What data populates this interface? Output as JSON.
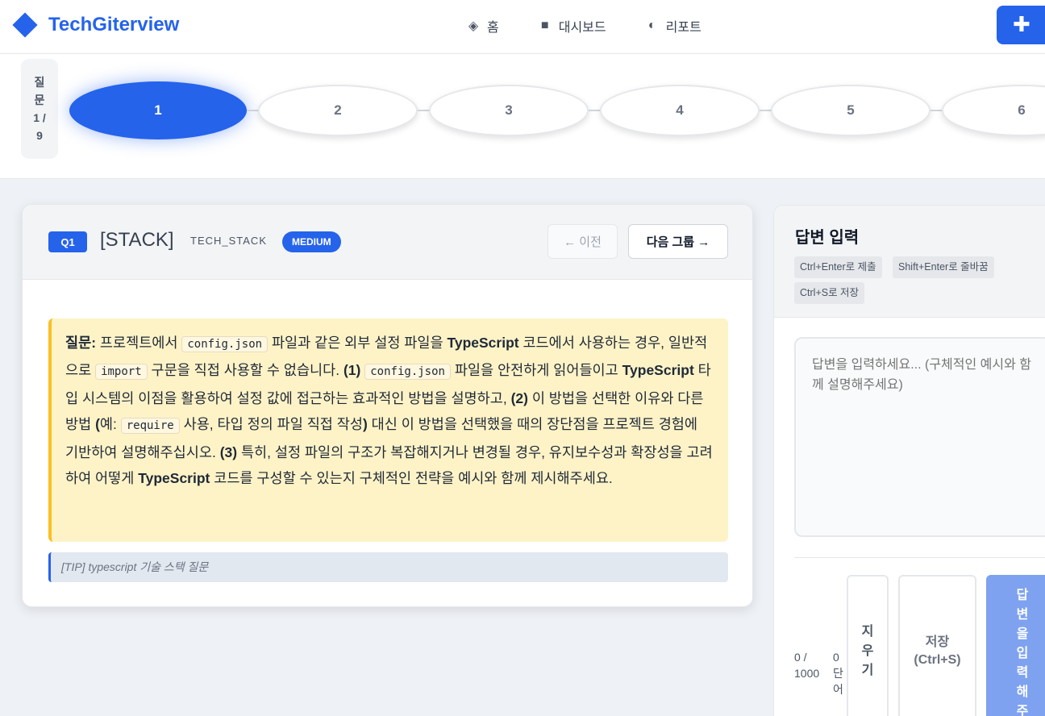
{
  "header": {
    "logo_text": "TechGiterview",
    "nav": [
      {
        "icon": "diamond-icon",
        "glyph": "◈",
        "label": "홈"
      },
      {
        "icon": "square-icon",
        "glyph": "■",
        "label": "대시보드"
      },
      {
        "icon": "half-circle-icon",
        "glyph": "◐",
        "label": "리포트"
      }
    ],
    "new_button_glyph": "✚"
  },
  "progress": {
    "counter_text": "질문 1 / 9",
    "steps": [
      "1",
      "2",
      "3",
      "4",
      "5",
      "6"
    ],
    "active_step": "1"
  },
  "question": {
    "badge": "Q1",
    "category": "[STACK]",
    "type": "TECH_STACK",
    "level": "MEDIUM",
    "prev_label": "← 이전",
    "next_label": "다음 그룹 →",
    "label": "질문:",
    "tip": "[TIP] typescript 기술 스택 질문",
    "body_parts": {
      "p1": " 프로젝트에서 ",
      "c1": "config.json",
      "p2": " 파일과 같은 외부 설정 파일을 ",
      "b1": "TypeScript",
      "p3": " 코드에서 사용하는 경우, 일반적으로 ",
      "c2": "import",
      "p4": " 구문을 직접 사용할 수 없습니다. ",
      "b2": "(1)",
      "p5": " ",
      "c3": "config.json",
      "p6": " 파일을 안전하게 읽어들이고 ",
      "b3": "TypeScript",
      "p7": " 타입 시스템의 이점을 활용하여 설정 값에 접근하는 효과적인 방법을 설명하고, ",
      "b4": "(2)",
      "p8": " 이 방법을 선택한 이유와 다른 방법 ",
      "b5": "(",
      "p9": "예: ",
      "c4": "require",
      "p10": " 사용, 타입 정의 파일 직접 작성",
      "b6": ")",
      "p11": " 대신 이 방법을 선택했을 때의 장단점을 프로젝트 경험에 기반하여 설명해주십시오. ",
      "b7": "(3)",
      "p12": " 특히, 설정 파일의 구조가 복잡해지거나 변경될 경우, 유지보수성과 확장성을 고려하여 어떻게 ",
      "b8": "TypeScript",
      "p13": " 코드를 구성할 수 있는지 구체적인 전략을 예시와 함께 제시해주세요."
    }
  },
  "answer": {
    "title": "답변 입력",
    "shortcuts": [
      "Ctrl+Enter로 제출",
      "Shift+Enter로 줄바꿈",
      "Ctrl+S로 저장"
    ],
    "placeholder": "답변을 입력하세요... (구체적인 예시와 함께 설명해주세요)",
    "value": "",
    "char_count": "0 / 1000",
    "word_count": "0 단어",
    "clear_label": "지우기",
    "save_label": "저장 (Ctrl+S)",
    "submit_label": "답변을 입력해주세요"
  },
  "colors": {
    "accent": "#2563eb",
    "question_bg": "#fef3c7",
    "question_border": "#fbbf24"
  }
}
